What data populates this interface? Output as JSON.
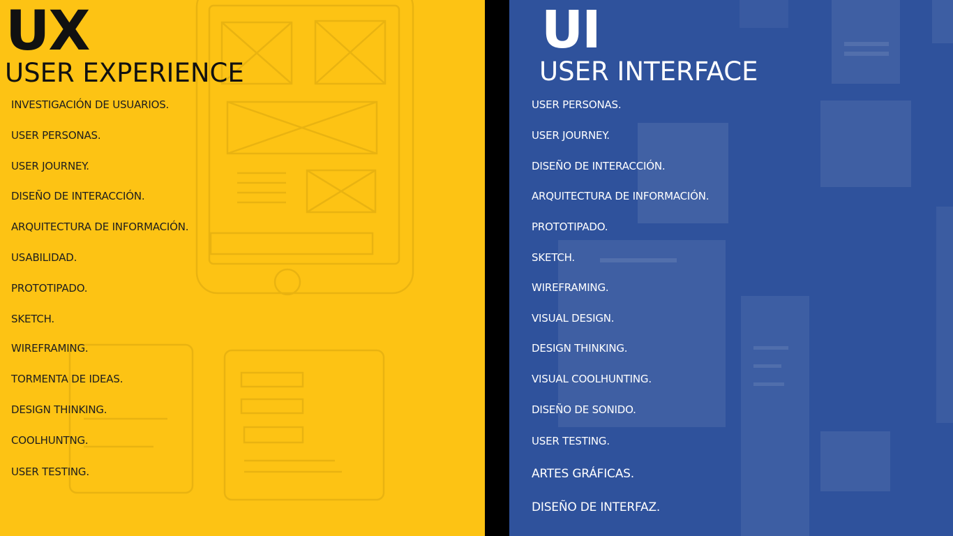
{
  "ux": {
    "abbr": "UX",
    "title": "USER EXPERIENCE",
    "items": [
      "INVESTIGACIÓN DE USUARIOS.",
      "USER PERSONAS.",
      "USER JOURNEY.",
      "DISEÑO DE INTERACCIÓN.",
      "ARQUITECTURA DE INFORMACIÓN.",
      "USABILIDAD.",
      "PROTOTIPADO.",
      "SKETCH.",
      "WIREFRAMING.",
      "TORMENTA DE IDEAS.",
      "DESIGN THINKING.",
      "COOLHUNTNG.",
      "USER TESTING."
    ]
  },
  "ui": {
    "abbr": "UI",
    "title": "USER INTERFACE",
    "items": [
      "USER PERSONAS.",
      "USER JOURNEY.",
      "DISEÑO DE INTERACCIÓN.",
      "ARQUITECTURA DE INFORMACIÓN.",
      "PROTOTIPADO.",
      "SKETCH.",
      "WIREFRAMING.",
      "VISUAL DESIGN.",
      "DESIGN THINKING.",
      "VISUAL COOLHUNTING.",
      "DISEÑO DE SONIDO.",
      "USER TESTING.",
      "ARTES GRÁFICAS.",
      "DISEÑO DE INTERFAZ."
    ]
  },
  "colors": {
    "ux_background": "#fdc314",
    "ui_background": "#2f529c",
    "divider": "#000000"
  }
}
